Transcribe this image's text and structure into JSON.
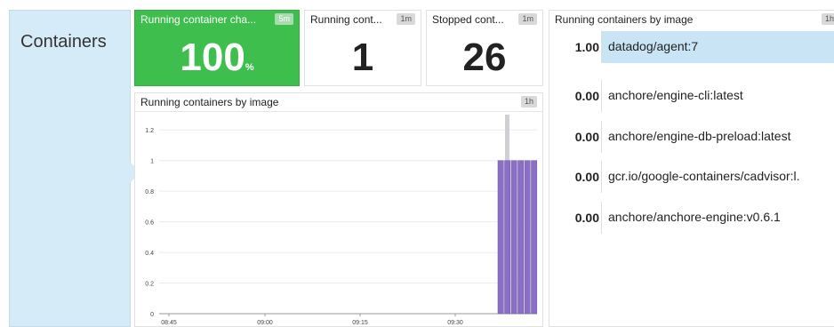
{
  "group": {
    "title": "Containers"
  },
  "widgets": {
    "running_change": {
      "title": "Running container cha...",
      "badge": "5m",
      "value": "100",
      "unit": "%",
      "color": "#3ebe4d"
    },
    "running_count": {
      "title": "Running cont...",
      "badge": "1m",
      "value": "1"
    },
    "stopped_count": {
      "title": "Stopped cont...",
      "badge": "1m",
      "value": "26"
    },
    "timeseries": {
      "title": "Running containers by image",
      "badge": "1h"
    },
    "toplist": {
      "title": "Running containers by image",
      "badge": "1h",
      "rows": [
        {
          "value": "1.00",
          "name": "datadog/agent:7"
        },
        {
          "value": "0.00",
          "name": "anchore/engine-cli:latest"
        },
        {
          "value": "0.00",
          "name": "anchore/engine-db-preload:latest"
        },
        {
          "value": "0.00",
          "name": "gcr.io/google-containers/cadvisor:l."
        },
        {
          "value": "0.00",
          "name": "anchore/anchore-engine:v0.6.1"
        }
      ]
    }
  },
  "chart_data": {
    "type": "bar",
    "ylim": [
      0,
      1.3
    ],
    "yticks": [
      "0",
      "0.2",
      "0.4",
      "0.6",
      "0.8",
      "1",
      "1.2"
    ],
    "xticks": [
      "08:45",
      "09:00",
      "09:15",
      "09:30"
    ],
    "bars_color": "#8a6fc5",
    "spike_color": "#cfcfd6",
    "bars": [
      1,
      1,
      1,
      1,
      1,
      1
    ],
    "spike": 1.3
  }
}
